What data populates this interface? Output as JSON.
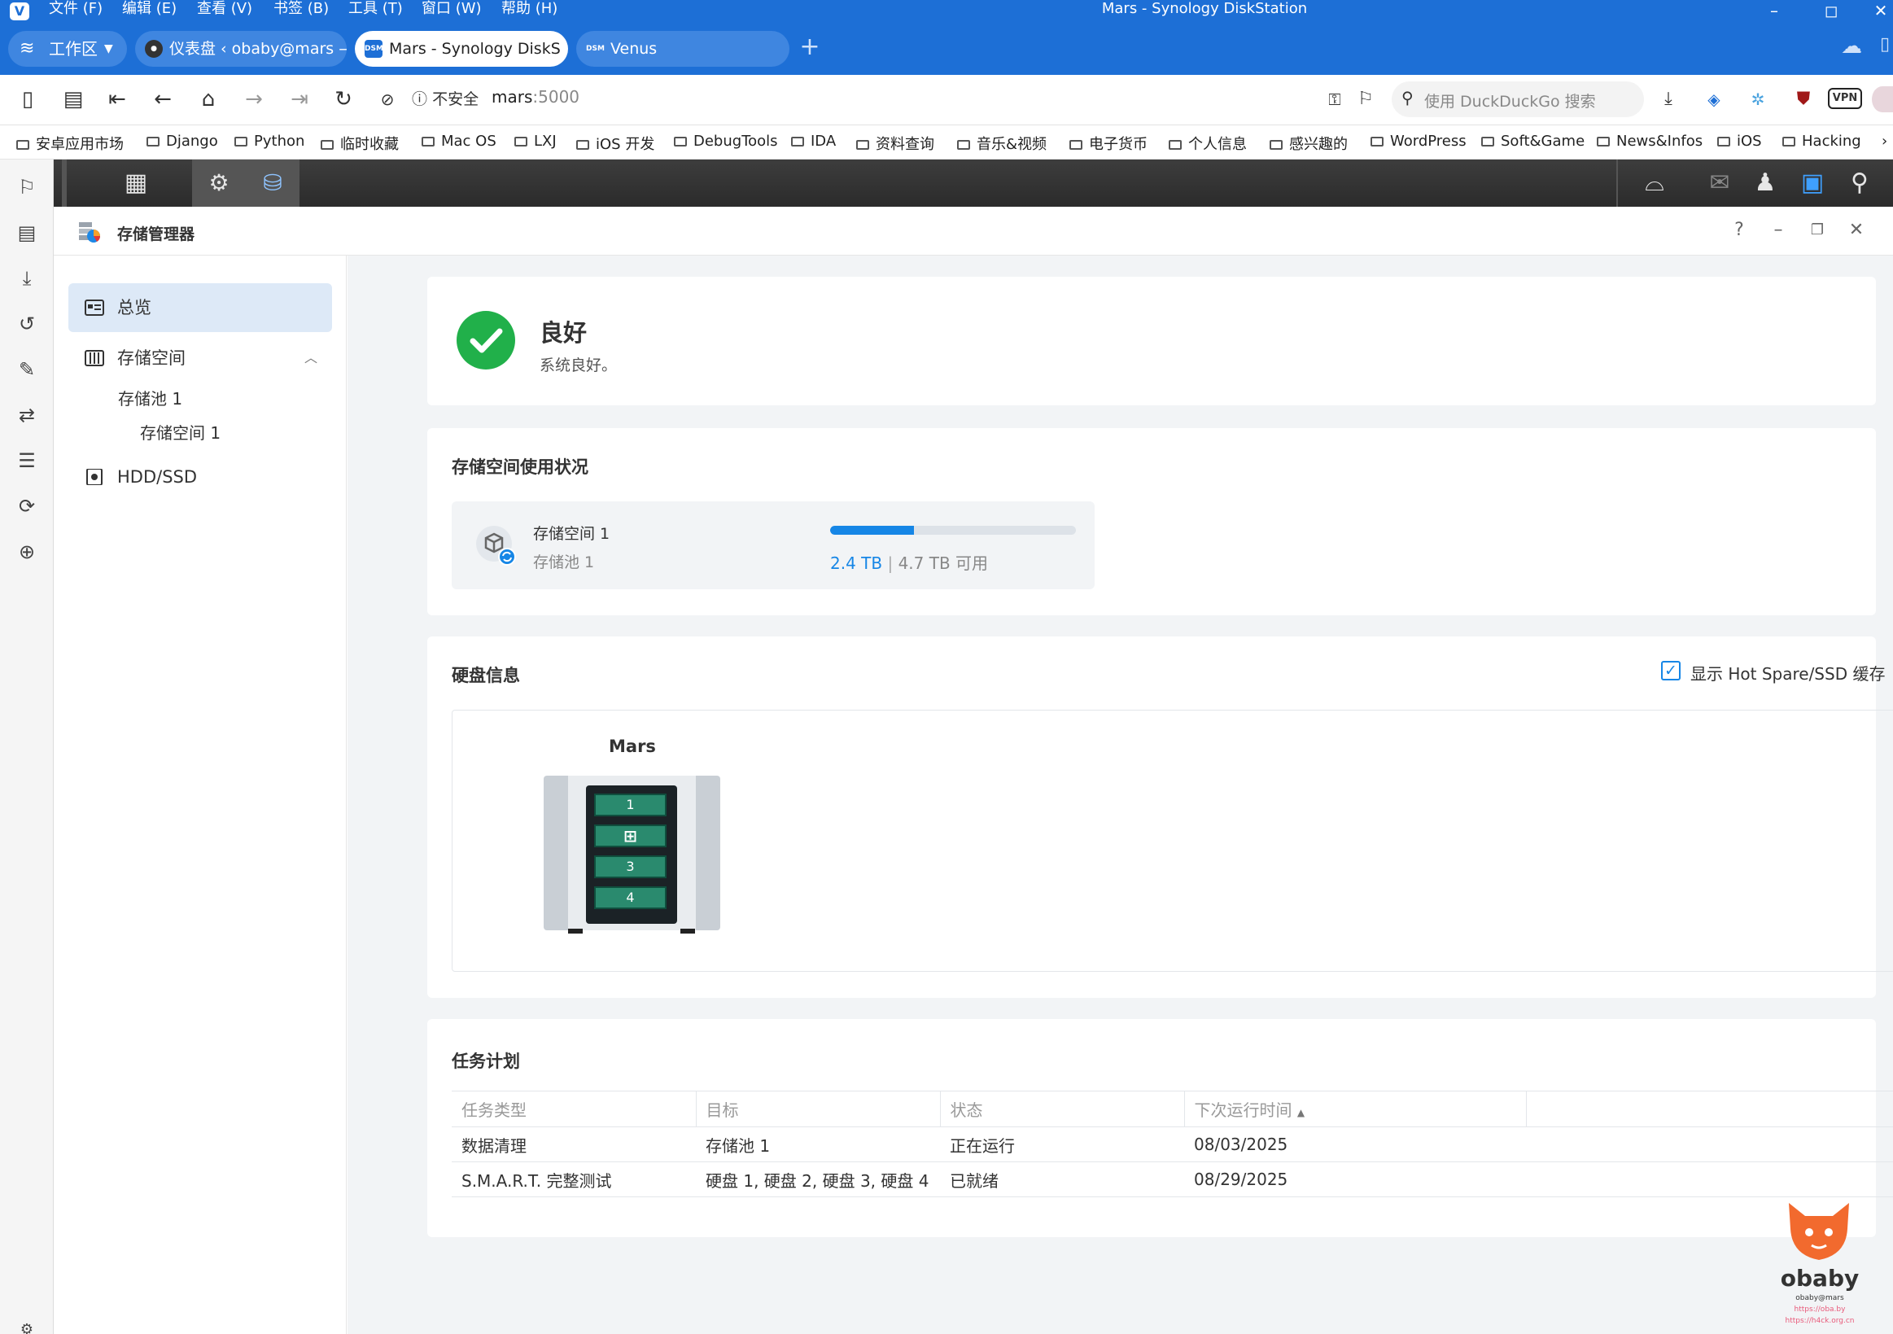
{
  "window": {
    "title": "Mars - Synology DiskStation",
    "menu": [
      "文件 (F)",
      "编辑 (E)",
      "查看 (V)",
      "书签 (B)",
      "工具 (T)",
      "窗口 (W)",
      "帮助 (H)"
    ]
  },
  "tabs": {
    "workspace": "工作区",
    "items": [
      {
        "label": "仪表盘 ‹ obaby@mars — W",
        "active": false
      },
      {
        "label": "Mars - Synology DiskStatio",
        "active": true,
        "favicon": "DSM"
      },
      {
        "label": "Venus",
        "active": false,
        "favicon": "DSM"
      }
    ]
  },
  "address": {
    "insecure_label": "不安全",
    "host": "mars",
    "port": ":5000",
    "search_placeholder": "使用 DuckDuckGo 搜索",
    "vpn_label": "VPN"
  },
  "bookmarks": [
    "安卓应用市场",
    "Django",
    "Python",
    "临时收藏",
    "Mac OS",
    "LXJ",
    "iOS 开发",
    "DebugTools",
    "IDA",
    "资料查询",
    "音乐&视频",
    "电子货币",
    "个人信息",
    "感兴趣的",
    "WordPress",
    "Soft&Game",
    "News&Infos",
    "iOS",
    "Hacking"
  ],
  "app": {
    "title": "存储管理器",
    "nav": {
      "overview": "总览",
      "storage": "存储空间",
      "pool": "存储池 1",
      "volume": "存储空间 1",
      "hdd": "HDD/SSD"
    },
    "status": {
      "title": "良好",
      "subtitle": "系统良好。"
    },
    "usage": {
      "section_title": "存储空间使用状况",
      "volume_name": "存储空间 1",
      "pool_name": "存储池 1",
      "used": "2.4 TB",
      "separator": "|",
      "available": "4.7 TB 可用",
      "used_fraction": 0.34
    },
    "disks": {
      "section_title": "硬盘信息",
      "checkbox_label": "显示 Hot Spare/SSD 缓存",
      "checkbox_checked": true,
      "nas_name": "Mars",
      "bays": [
        "1",
        "",
        "3",
        "4"
      ]
    },
    "tasks": {
      "section_title": "任务计划",
      "columns": [
        "任务类型",
        "目标",
        "状态",
        "下次运行时间"
      ],
      "rows": [
        {
          "type": "数据清理",
          "target": "存储池 1",
          "status": "正在运行",
          "next": "08/03/2025"
        },
        {
          "type": "S.M.A.R.T. 完整测试",
          "target": "硬盘 1, 硬盘 2, 硬盘 3, 硬盘 4",
          "status": "已就绪",
          "next": "08/29/2025"
        }
      ]
    }
  },
  "watermark": {
    "text": "obaby",
    "sub": "obaby@mars",
    "url1": "https://oba.by",
    "url2": "https://h4ck.org.cn"
  },
  "colors": {
    "browser_blue": "#1d6fd6",
    "accent": "#1686e6",
    "ok_green": "#21b04a"
  }
}
